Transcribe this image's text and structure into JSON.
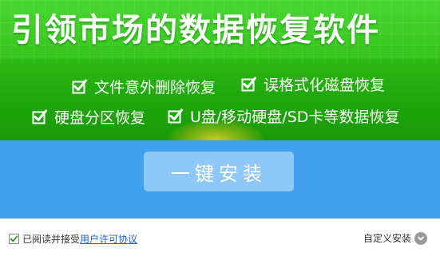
{
  "banner": {
    "headline": "引领市场的数据恢复软件",
    "features": [
      "文件意外删除恢复",
      "误格式化磁盘恢复",
      "硬盘分区恢复",
      "U盘/移动硬盘/SD卡等数据恢复"
    ]
  },
  "install": {
    "button_label": "一键安装"
  },
  "footer": {
    "agree_text": "已阅读并接受",
    "agree_link": "用户许可协议",
    "agree_checked": true,
    "custom_install_label": "自定义安装"
  },
  "colors": {
    "banner_green": "#2fbe16",
    "install_blue": "#3fa0f0",
    "button_blue": "#8ec8f8",
    "link_blue": "#1a5fd0"
  },
  "icons": {
    "feature_check": "checkbox-checked-icon",
    "agree_check": "checkmark-icon",
    "custom_chevron": "chevron-down-icon"
  }
}
